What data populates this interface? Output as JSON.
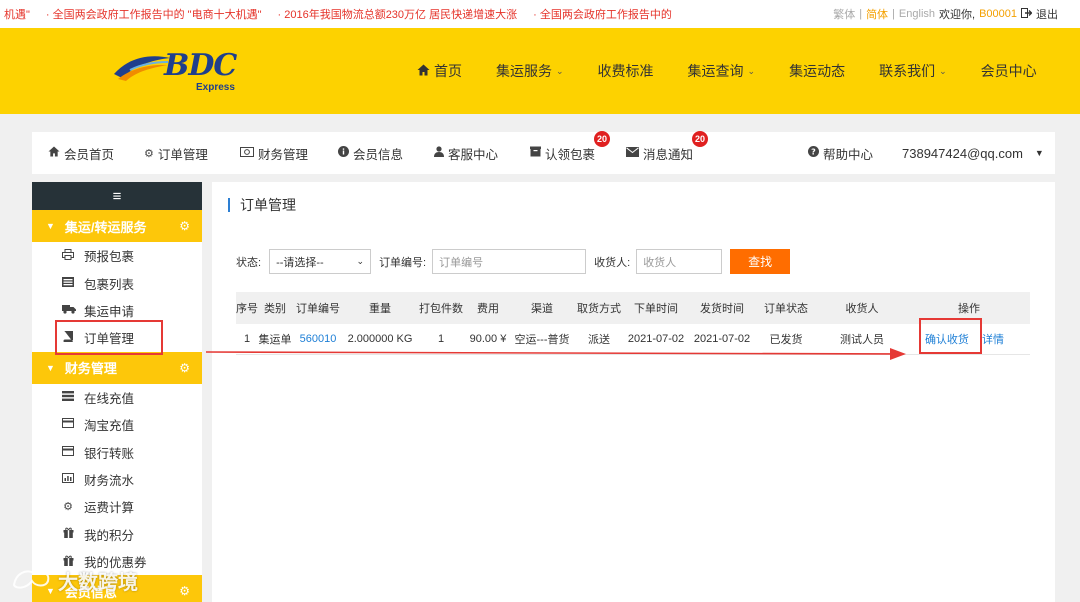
{
  "ticker": [
    "机遇\"",
    "· 全国两会政府工作报告中的 \"电商十大机遇\"",
    "· 2016年我国物流总额230万亿 居民快递增速大涨",
    "· 全国两会政府工作报告中的"
  ],
  "top_right": {
    "lang_trad": "繁体",
    "sep1": "|",
    "lang_simp": "简体",
    "sep2": "|",
    "lang_en": "English",
    "welcome": "欢迎你,",
    "user": "B00001",
    "logout": "退出"
  },
  "logo": {
    "brand": "BDC",
    "sub": "Express"
  },
  "nav": [
    {
      "label": "首页",
      "icon": "home-icon",
      "chev": ""
    },
    {
      "label": "集运服务",
      "chev": "⌄"
    },
    {
      "label": "收费标准",
      "chev": ""
    },
    {
      "label": "集运查询",
      "chev": "⌄"
    },
    {
      "label": "集运动态",
      "chev": ""
    },
    {
      "label": "联系我们",
      "chev": "⌄"
    },
    {
      "label": "会员中心",
      "chev": ""
    }
  ],
  "member_bar": {
    "home": "会员首页",
    "orders": "订单管理",
    "finance": "财务管理",
    "info": "会员信息",
    "service": "客服中心",
    "claim": "认领包裹",
    "claim_badge": "20",
    "messages": "消息通知",
    "messages_badge": "20",
    "help": "帮助中心",
    "email": "738947424@qq.com"
  },
  "sidebar": {
    "sections": [
      {
        "label": "集运/转运服务",
        "items": [
          "预报包裹",
          "包裹列表",
          "集运申请",
          "订单管理"
        ]
      },
      {
        "label": "财务管理",
        "items": [
          "在线充值",
          "淘宝充值",
          "银行转账",
          "财务流水",
          "运费计算",
          "我的积分",
          "我的优惠券"
        ]
      },
      {
        "label": "会员信息",
        "items": []
      }
    ]
  },
  "main": {
    "title": "订单管理",
    "filter": {
      "status_label": "状态:",
      "status_value": "--请选择--",
      "order_no_label": "订单编号:",
      "order_no_placeholder": "订单编号",
      "receiver_label": "收货人:",
      "receiver_placeholder": "收货人",
      "search_button": "查找"
    },
    "table": {
      "headers": [
        "序号",
        "类别",
        "订单编号",
        "重量",
        "打包件数",
        "费用",
        "渠道",
        "取货方式",
        "下单时间",
        "发货时间",
        "订单状态",
        "收货人",
        "操作"
      ],
      "rows": [
        {
          "index": "1",
          "type": "集运单",
          "order_no": "560010",
          "weight": "2.000000 KG",
          "pieces": "1",
          "fee": "90.00 ¥",
          "channel": "空运---普货",
          "pickup": "派送",
          "order_time": "2021-07-02",
          "ship_time": "2021-07-02",
          "status": "已发货",
          "receiver": "测试人员",
          "action_confirm": "确认收货",
          "action_detail": "详情"
        }
      ]
    }
  },
  "watermark": "大数跨境",
  "colors": {
    "header": "#fdd200",
    "accent": "#fdc70a",
    "search": "#ff6d00",
    "link": "#1e7fd6",
    "highlight": "#e53935",
    "badge": "#e02020"
  }
}
